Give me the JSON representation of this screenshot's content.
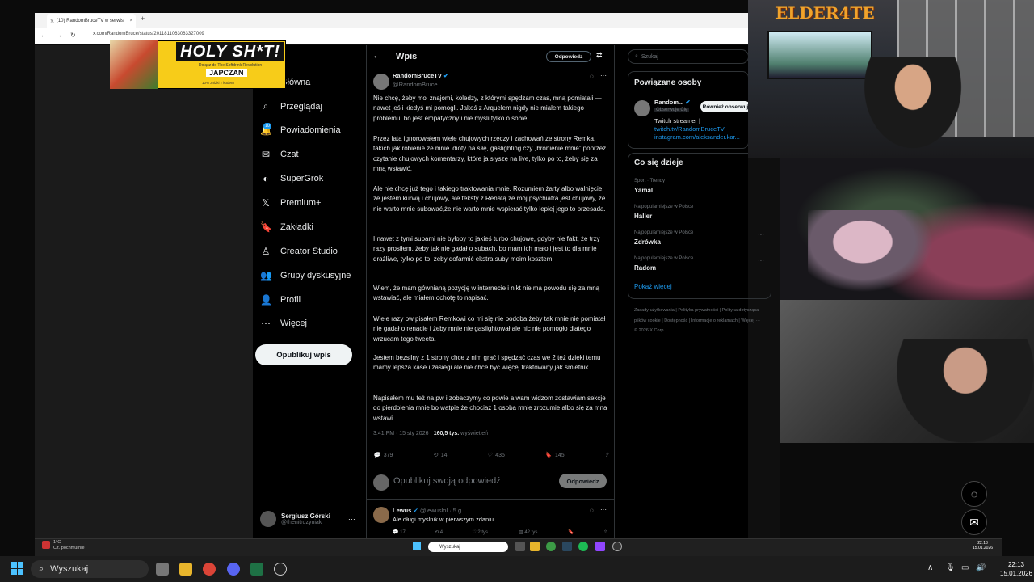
{
  "browser": {
    "tab_title": "(10) RandomBruceTV w serwisi",
    "new_tab": "+",
    "url": "x.com/RandomBruce/status/2011811063063327009"
  },
  "ad": {
    "title": "HOLY SH*T!",
    "subtitle": "Dołącz do The Softdrink Revolution",
    "brand": "JAPCZAN",
    "small": "10% zniżki z kodem"
  },
  "sidebar": {
    "items": [
      {
        "label": "Główna",
        "icon": "home-icon",
        "glyph": "⌂"
      },
      {
        "label": "Przeglądaj",
        "icon": "search-icon",
        "glyph": "⌕"
      },
      {
        "label": "Powiadomienia",
        "icon": "bell-icon",
        "glyph": "🔔"
      },
      {
        "label": "Czat",
        "icon": "mail-icon",
        "glyph": "✉"
      },
      {
        "label": "SuperGrok",
        "icon": "grok-icon",
        "glyph": "◐"
      },
      {
        "label": "Premium+",
        "icon": "x-logo-icon",
        "glyph": "𝕏"
      },
      {
        "label": "Zakładki",
        "icon": "bookmark-icon",
        "glyph": "🔖"
      },
      {
        "label": "Creator Studio",
        "icon": "creator-icon",
        "glyph": "♙"
      },
      {
        "label": "Grupy dyskusyjne",
        "icon": "communities-icon",
        "glyph": "👥"
      },
      {
        "label": "Profil",
        "icon": "profile-icon",
        "glyph": "👤"
      },
      {
        "label": "Więcej",
        "icon": "more-icon",
        "glyph": "⋯"
      }
    ],
    "badge": "10",
    "post_button": "Opublikuj wpis",
    "account": {
      "name": "Sergiusz Górski",
      "handle": "@thenitrozyniak"
    }
  },
  "header": {
    "title": "Wpis",
    "reply_button": "Odpowiedz"
  },
  "post": {
    "author_name": "RandomBruceTV",
    "author_handle": "@RandomBruce",
    "paragraphs": [
      "Nie chcę, żeby moi znajomi, koledzy, z którymi spędzam czas, mną pomiatali — nawet jeśli kiedyś mi pomogli. Jakoś z Arquelem nigdy nie miałem takiego problemu, bo jest empatyczny i nie myśli tylko o sobie.",
      "Przez lata ignorowałem wiele chujowych rzeczy i zachowań ze strony Remka, takich jak robienie ze mnie idioty na siłę, gaslighting czy „bronienie mnie” poprzez czytanie chujowych komentarzy, które ja słyszę na live, tylko po to, żeby się za mną wstawić.",
      "Ale nie chcę już tego i takiego traktowania mnie. Rozumiem żarty albo walnięcie, że jestem kurwą i chujowy, ale teksty z Renatą  że mój psychiatra jest chujowy, że nie warto mnie subować,że nie warto mnie wspierać tylko lepiej jego  to przesada.",
      "I nawet z tymi subami nie byłoby to jakieś turbo chujowe, gdyby nie fakt, że trzy razy prosiłem, żeby tak nie gadał o subach, bo mam ich mało i jest to dla mnie drażliwe, tylko po to, żeby dofarmić ekstra suby moim kosztem.",
      "Wiem, że mam gównianą pozycję w internecie i nikt nie ma powodu się za mną wstawiać, ale miałem ochotę to napisać.",
      "Wiele razy pw pisałem Remkowi co mi się nie podoba żeby tak mnie nie pomiatał nie gadał o renacie i żeby mnie nie gaslightował ale nic nie pomogło dlatego wrzucam tego tweeta.",
      "Jestem bezsilny z 1 strony chce z nim grać i spędzać czas we 2 też dzięki temu mamy lepsza kase i zasiegi ale nie chce byc więcej traktowany jak śmietnik.",
      "Napisałem mu też na pw i zobaczymy co powie a wam widzom zostawiam sekcje do pierdolenia mnie bo wątpie że chociaż 1 osoba mnie zrozumie albo się za mna wstawi."
    ],
    "time": "3:41 PM · 15 sty 2026 · ",
    "views": "160,5 tys.",
    "views_label": " wyświetleń",
    "replies": "379",
    "reposts": "14",
    "likes": "435",
    "bookmarks": "145"
  },
  "compose": {
    "placeholder": "Opublikuj swoją odpowiedź",
    "button": "Odpowiedz"
  },
  "reply": {
    "name": "Lewus",
    "handle": "@lewuslol · 5 g.",
    "text": "Ale długi myślnik w pierwszym zdaniu",
    "replies": "17",
    "reposts": "4",
    "likes": "2 tys.",
    "views": "42 tys."
  },
  "right": {
    "search_placeholder": "Szukaj",
    "related_title": "Powiązane osoby",
    "related_name": "Random...",
    "related_follows": "Obserwuje Cię",
    "related_button": "Również obserwuj",
    "related_bio": "Twitch streamer |",
    "related_link1": "twitch.tv/RandomBruceTV",
    "related_link2": "instagram.com/aleksander.kar...",
    "trends_title": "Co się dzieje",
    "trends": [
      {
        "ctx": "Sport · Trendy",
        "name": "Yamal"
      },
      {
        "ctx": "Najpopularniejsze w Polsce",
        "name": "Haller"
      },
      {
        "ctx": "Najpopularniejsze w Polsce",
        "name": "Zdrówka"
      },
      {
        "ctx": "Najpopularniejsze w Polsce",
        "name": "Radom"
      }
    ],
    "show_more": "Pokaż więcej",
    "footer": "Zasady użytkowania  |  Polityka prywatności  |  Polityka dotycząca plików cookie  |  Dostępność  |  Informacje o reklamach  |  Więcej ···  © 2026 X Corp."
  },
  "overlay": {
    "streamer_logo": "ELDER4TE"
  },
  "inner_taskbar": {
    "weather_temp": "1°C",
    "weather_desc": "Cz. pochmurnie",
    "search": "Wyszukaj",
    "time": "22:13",
    "date": "15.01.2026"
  },
  "taskbar": {
    "search": "Wyszukaj",
    "time": "22:13",
    "date": "15.01.2026"
  }
}
